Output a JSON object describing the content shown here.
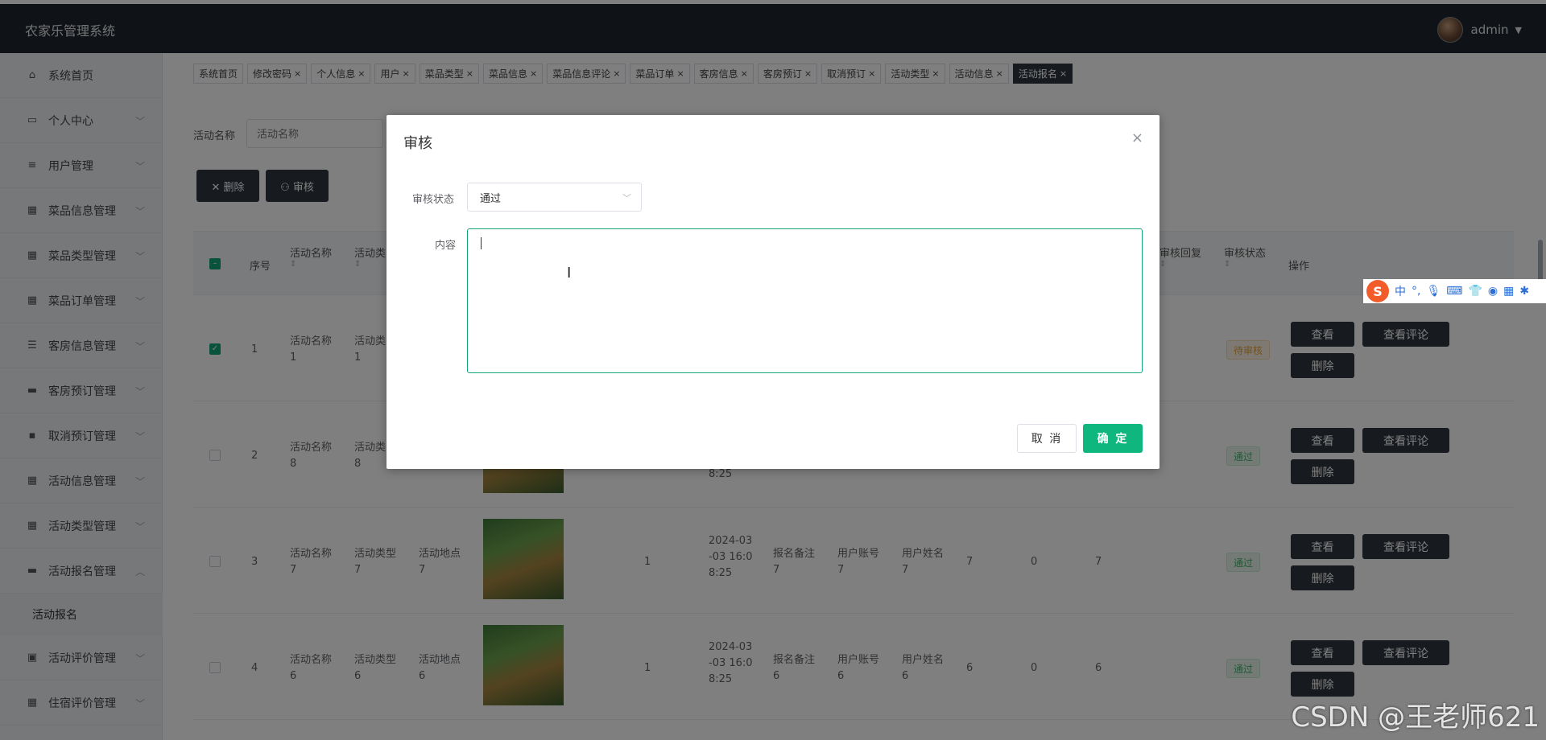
{
  "app": {
    "title": "农家乐管理系统",
    "user": "admin"
  },
  "sidebar": {
    "items": [
      {
        "label": "系统首页",
        "icon": "home-icon"
      },
      {
        "label": "个人中心",
        "icon": "calendar-icon"
      },
      {
        "label": "用户管理",
        "icon": "sliders-icon"
      },
      {
        "label": "菜品信息管理",
        "icon": "grid-icon"
      },
      {
        "label": "菜品类型管理",
        "icon": "grid-icon"
      },
      {
        "label": "菜品订单管理",
        "icon": "grid-icon"
      },
      {
        "label": "客房信息管理",
        "icon": "list-icon"
      },
      {
        "label": "客房预订管理",
        "icon": "monitor-icon"
      },
      {
        "label": "取消预订管理",
        "icon": "chat-icon"
      },
      {
        "label": "活动信息管理",
        "icon": "apps-icon"
      },
      {
        "label": "活动类型管理",
        "icon": "grid-icon"
      },
      {
        "label": "活动报名管理",
        "icon": "laptop-icon"
      },
      {
        "label": "活动评价管理",
        "icon": "clipboard-icon"
      },
      {
        "label": "住宿评价管理",
        "icon": "grid-icon"
      }
    ],
    "sub_item": "活动报名"
  },
  "tabs": [
    {
      "label": "系统首页",
      "closable": false
    },
    {
      "label": "修改密码",
      "closable": true
    },
    {
      "label": "个人信息",
      "closable": true
    },
    {
      "label": "用户",
      "closable": true
    },
    {
      "label": "菜品类型",
      "closable": true
    },
    {
      "label": "菜品信息",
      "closable": true
    },
    {
      "label": "菜品信息评论",
      "closable": true
    },
    {
      "label": "菜品订单",
      "closable": true
    },
    {
      "label": "客房信息",
      "closable": true
    },
    {
      "label": "客房预订",
      "closable": true
    },
    {
      "label": "取消预订",
      "closable": true
    },
    {
      "label": "活动类型",
      "closable": true
    },
    {
      "label": "活动信息",
      "closable": true
    },
    {
      "label": "活动报名",
      "closable": true,
      "active": true
    }
  ],
  "search": {
    "label": "活动名称",
    "placeholder": "活动名称"
  },
  "toolbar": {
    "delete_label": "✕ 删除",
    "audit_label": "⚇ 审核"
  },
  "table": {
    "headers": {
      "index": "序号",
      "name": "活动名称",
      "type": "活动类",
      "reply": "审核回复",
      "status": "审核状态",
      "ops": "操作"
    },
    "rows": [
      {
        "idx": "1",
        "name": "活动名称\n1",
        "type": "活动类\n1",
        "checked": true,
        "status": "待审核",
        "status_kind": "pending"
      },
      {
        "idx": "2",
        "name": "活动名称\n8",
        "type": "活动类\n8",
        "time_tail": "8:25",
        "checked": false,
        "status": "通过",
        "status_kind": "pass"
      },
      {
        "idx": "3",
        "name": "活动名称\n7",
        "type": "活动类型\n7",
        "place": "活动地点\n7",
        "count": "1",
        "time": "2024-03\n-03 16:0\n8:25",
        "remark": "报名备注\n7",
        "account": "用户账号\n7",
        "username": "用户姓名\n7",
        "n1": "7",
        "n2": "0",
        "n3": "7",
        "checked": false,
        "status": "通过",
        "status_kind": "pass"
      },
      {
        "idx": "4",
        "name": "活动名称\n6",
        "type": "活动类型\n6",
        "place": "活动地点\n6",
        "count": "1",
        "time": "2024-03\n-03 16:0\n8:25",
        "remark": "报名备注\n6",
        "account": "用户账号\n6",
        "username": "用户姓名\n6",
        "n1": "6",
        "n2": "0",
        "n3": "6",
        "checked": false,
        "status": "通过",
        "status_kind": "pass"
      }
    ],
    "row_ops": {
      "view": "查看",
      "view_comments": "查看评论",
      "delete": "删除"
    }
  },
  "dialog": {
    "title": "审核",
    "status_label": "审核状态",
    "status_value": "通过",
    "content_label": "内容",
    "content_value": "",
    "cancel_label": "取 消",
    "confirm_label": "确 定"
  },
  "ime": {
    "chinese_label": "中"
  },
  "watermark": "CSDN @王老师621",
  "colors": {
    "header_bg": "#1f262e",
    "accent": "#0fb77e",
    "dark_button": "#2f3740"
  }
}
